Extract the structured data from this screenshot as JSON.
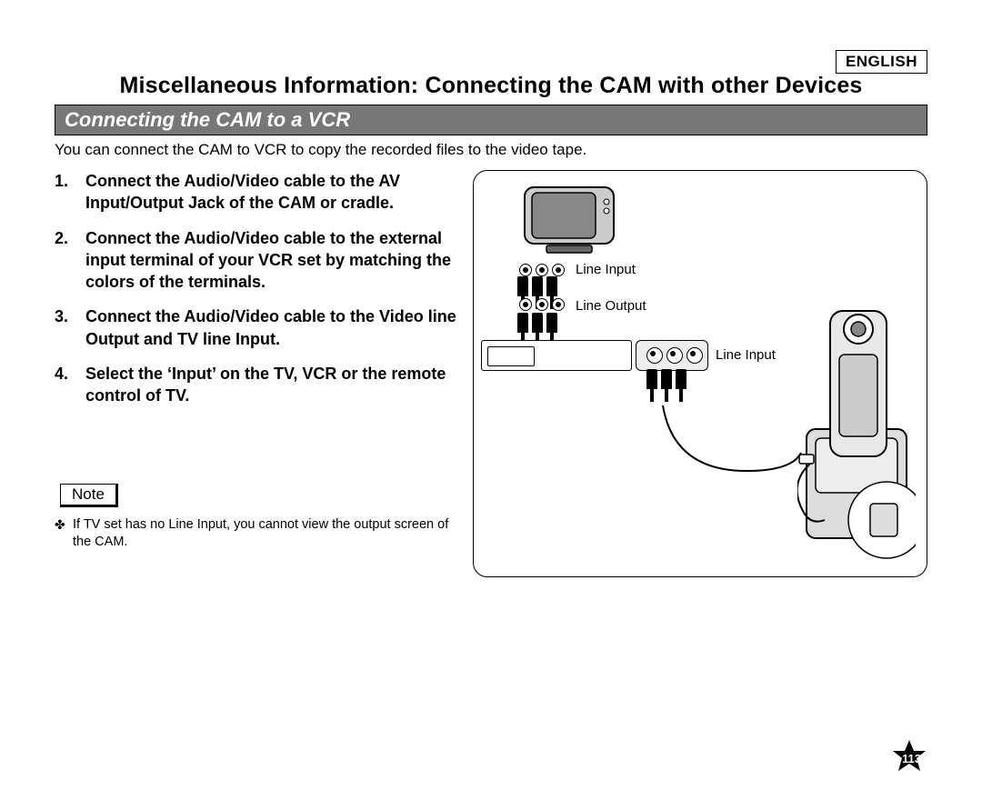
{
  "language": "ENGLISH",
  "main_title": "Miscellaneous Information: Connecting the CAM with other Devices",
  "subtitle": "Connecting the CAM to a VCR",
  "intro": "You can connect the CAM to VCR to copy the recorded files to the video tape.",
  "steps": [
    {
      "n": "1.",
      "t": "Connect the Audio/Video cable to the AV Input/Output Jack of the CAM or cradle."
    },
    {
      "n": "2.",
      "t": "Connect the Audio/Video cable to the external input terminal of your VCR set by matching the colors of the terminals."
    },
    {
      "n": "3.",
      "t": "Connect the Audio/Video cable to the Video line Output and TV line Input."
    },
    {
      "n": "4.",
      "t": "Select the ‘Input’ on the TV, VCR or the remote control of TV."
    }
  ],
  "note_label": "Note",
  "notes": [
    "If TV set has no Line Input, you cannot view the output screen of the CAM."
  ],
  "diagram": {
    "label_line_input_top": "Line Input",
    "label_line_output": "Line Output",
    "label_line_input_vcr": "Line Input"
  },
  "page_number": "113"
}
